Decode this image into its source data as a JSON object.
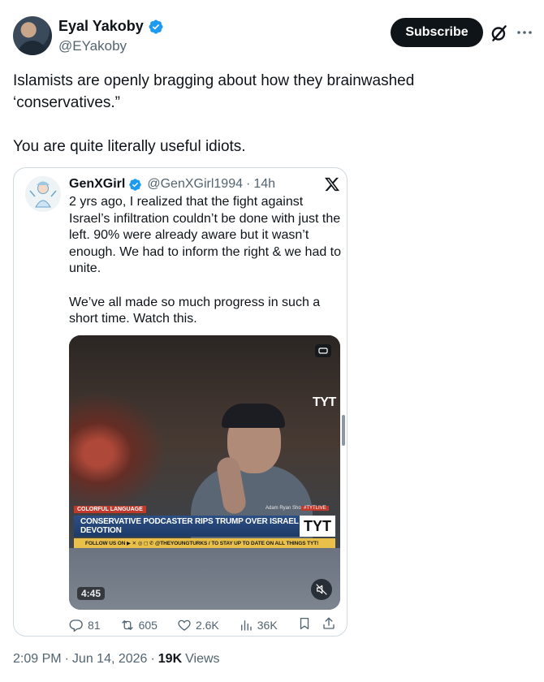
{
  "author": {
    "name": "Eyal Yakoby",
    "handle": "@EYakoby",
    "verified": true
  },
  "actions_header": {
    "subscribe_label": "Subscribe",
    "more_icon": "more-icon",
    "grok_icon": "grok-icon"
  },
  "tweet_text": "Islamists are openly bragging about how they brainwashed\n‘conservatives.”\n\nYou are quite literally useful idiots.",
  "quote": {
    "name": "GenXGirl",
    "handle": "@GenXGirl1994",
    "separator": "·",
    "time": "14h",
    "text": "2 yrs ago, I realized that the fight against Israel’s infiltration couldn’t be done with just the left. 90% were already aware but it wasn’t enough. We had to inform the right & we had to unite.\n\nWe’ve all made so much progress in such a short time. Watch this.",
    "video": {
      "channel_logo": "TYT",
      "tag": "COLORFUL LANGUAGE",
      "show_name": "Adam Ryan Show",
      "hashtag": "#TYTLIVE",
      "headline": "CONSERVATIVE PODCASTER RIPS TRUMP OVER ISRAEL DEVOTION",
      "banner_logo": "TYT",
      "ticker": "FOLLOW US ON ▶ ✕ ◎ ◻ ✆ @THEYOUNGTURKS / TO STAY UP TO DATE ON ALL THINGS TYT!",
      "duration": "4:45"
    },
    "stats": {
      "replies": "81",
      "reposts": "605",
      "likes": "2.6K",
      "views": "36K"
    }
  },
  "meta": {
    "time": "2:09 PM",
    "sep1": "·",
    "date": "Jun 14, 2026",
    "sep2": "·",
    "views_count": "19K",
    "views_label": "Views"
  },
  "colors": {
    "accent_verified": "#1d9bf0",
    "text_primary": "#0f1419",
    "text_secondary": "#536471",
    "border": "#cfd9de"
  }
}
